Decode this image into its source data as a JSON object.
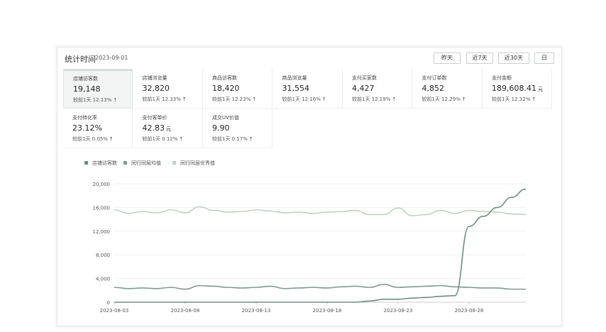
{
  "header": {
    "title": "统计时间",
    "date": "2023-09-01",
    "range_buttons": [
      "昨天",
      "近7天",
      "近30天",
      "日"
    ]
  },
  "metrics": [
    {
      "label": "店铺访客数",
      "value": "19,148",
      "unit": "",
      "compare": "较前1天  12.13%",
      "trend": "up",
      "active": true
    },
    {
      "label": "店铺浏览量",
      "value": "32,820",
      "unit": "",
      "compare": "较前1天  12.33%",
      "trend": "up",
      "active": false
    },
    {
      "label": "商品访客数",
      "value": "18,420",
      "unit": "",
      "compare": "较前1天  12.23%",
      "trend": "up",
      "active": false
    },
    {
      "label": "商品浏览量",
      "value": "31,554",
      "unit": "",
      "compare": "较前1天  12.16%",
      "trend": "up",
      "active": false
    },
    {
      "label": "支付买家数",
      "value": "4,427",
      "unit": "",
      "compare": "较前1天  12.19%",
      "trend": "up",
      "active": false
    },
    {
      "label": "支付订单数",
      "value": "4,852",
      "unit": "",
      "compare": "较前1天  12.29%",
      "trend": "up",
      "active": false
    },
    {
      "label": "支付金额",
      "value": "189,608.41",
      "unit": "元",
      "compare": "较前1天  12.32%",
      "trend": "up",
      "active": false
    },
    {
      "label": "支付转化率",
      "value": "23.12%",
      "unit": "",
      "compare": "较前1天  0.05%",
      "trend": "up",
      "active": false
    },
    {
      "label": "支付客单价",
      "value": "42.83",
      "unit": "元",
      "compare": "较前1天  0.12%",
      "trend": "up",
      "active": false
    },
    {
      "label": "成交UV价值",
      "value": "9.90",
      "unit": "",
      "compare": "较前1天  0.17%",
      "trend": "up",
      "active": false
    }
  ],
  "icons": {
    "trend_up": "arrow-up-icon"
  },
  "colors": {
    "series_primary": "#6f8d82",
    "series_average": "#7f9a92",
    "series_excellent": "#c3d0c5",
    "axis": "#cccccc",
    "grid": "#efefef"
  },
  "chart_data": {
    "type": "line",
    "ylim": [
      0,
      20000
    ],
    "y_ticks": [
      "0",
      "4,000",
      "8,000",
      "12,000",
      "16,000",
      "20,000"
    ],
    "x_ticks": [
      "2023-08-03",
      "2023-08-08",
      "2023-08-13",
      "2023-08-18",
      "2023-08-23",
      "2023-08-28"
    ],
    "x": [
      "2023-08-03",
      "2023-08-04",
      "2023-08-05",
      "2023-08-06",
      "2023-08-07",
      "2023-08-08",
      "2023-08-09",
      "2023-08-10",
      "2023-08-11",
      "2023-08-12",
      "2023-08-13",
      "2023-08-14",
      "2023-08-15",
      "2023-08-16",
      "2023-08-17",
      "2023-08-18",
      "2023-08-19",
      "2023-08-20",
      "2023-08-21",
      "2023-08-22",
      "2023-08-23",
      "2023-08-24",
      "2023-08-25",
      "2023-08-26",
      "2023-08-27",
      "2023-08-28",
      "2023-08-29",
      "2023-08-30",
      "2023-08-31",
      "2023-09-01"
    ],
    "series": [
      {
        "name": "店铺访客数",
        "values": [
          0,
          0,
          0,
          0,
          0,
          0,
          0,
          0,
          0,
          0,
          0,
          0,
          0,
          0,
          0,
          0,
          0,
          0,
          200,
          500,
          500,
          700,
          800,
          1000,
          1100,
          12800,
          14500,
          16000,
          17700,
          19100
        ]
      },
      {
        "name": "同行同层均值",
        "values": [
          2500,
          2300,
          2400,
          2300,
          2500,
          2200,
          2800,
          2700,
          2500,
          2400,
          2500,
          2700,
          2300,
          2400,
          2500,
          2400,
          2600,
          2700,
          2500,
          3000,
          2500,
          2600,
          2700,
          2800,
          2600,
          2500,
          2400,
          2400,
          2200,
          2200
        ]
      },
      {
        "name": "同行同层优秀值",
        "values": [
          15600,
          15000,
          15300,
          15100,
          15600,
          15100,
          16100,
          15500,
          15200,
          15300,
          15600,
          15400,
          15100,
          15200,
          15000,
          15200,
          15300,
          15500,
          14800,
          14800,
          15900,
          14600,
          14800,
          15500,
          15000,
          15500,
          15300,
          15200,
          14900,
          14800
        ]
      }
    ]
  }
}
